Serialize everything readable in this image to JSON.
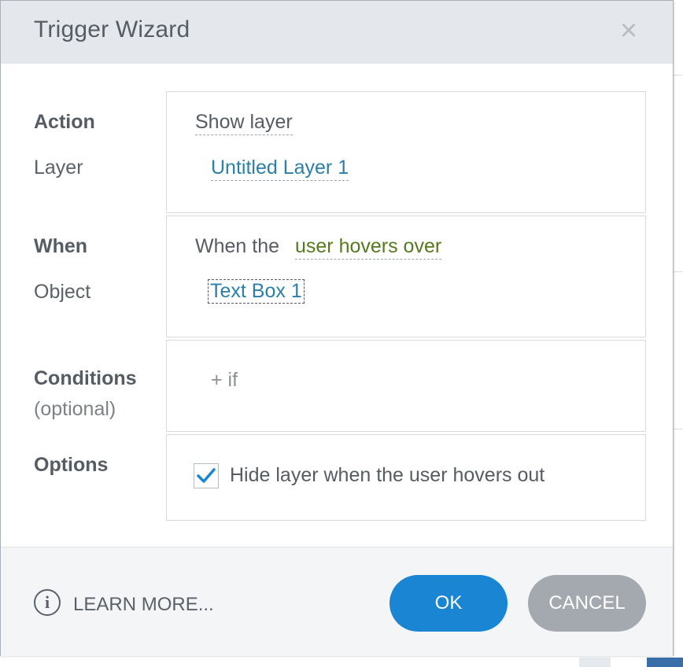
{
  "dialog": {
    "title": "Trigger Wizard",
    "close_glyph": "×"
  },
  "action": {
    "label": "Action",
    "value": "Show layer"
  },
  "layer": {
    "label": "Layer",
    "value": "Untitled Layer 1"
  },
  "when": {
    "label": "When",
    "prefix": "When the",
    "value": "user hovers over"
  },
  "object": {
    "label": "Object",
    "value": "Text Box 1"
  },
  "conditions": {
    "label": "Conditions",
    "sublabel": "(optional)",
    "add_label": "+ if"
  },
  "options": {
    "label": "Options",
    "hide_layer_checkbox": {
      "checked": true,
      "label": "Hide layer when the user hovers out"
    }
  },
  "footer": {
    "info_glyph": "i",
    "learn_more": "LEARN MORE...",
    "ok": "OK",
    "cancel": "CANCEL"
  },
  "colors": {
    "accent": "#1a86d3",
    "link": "#2b7fa8",
    "event": "#557a1e",
    "cancel": "#a3a9ae"
  }
}
